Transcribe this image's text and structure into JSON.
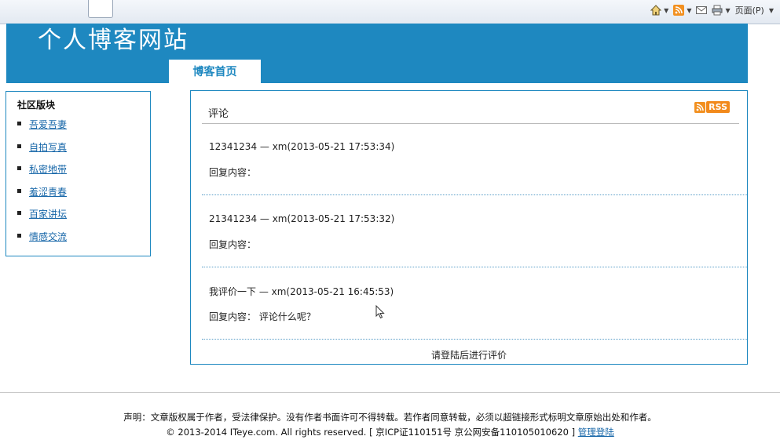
{
  "browser": {
    "page_menu": "页面(P)"
  },
  "header": {
    "site_title": "个人博客网站",
    "nav_tab": "博客首页"
  },
  "sidebar": {
    "title": "社区版块",
    "items": [
      {
        "label": "吾爱吾妻"
      },
      {
        "label": "自拍写真"
      },
      {
        "label": "私密地带"
      },
      {
        "label": "羞涩青春"
      },
      {
        "label": "百家讲坛"
      },
      {
        "label": "情感交流"
      }
    ]
  },
  "main": {
    "title": "评论",
    "rss_label": "RSS",
    "comments": [
      {
        "head": "12341234 — xm(2013-05-21 17:53:34)",
        "body": "回复内容："
      },
      {
        "head": "21341234 — xm(2013-05-21 17:53:32)",
        "body": "回复内容："
      },
      {
        "head": "我评价一下 — xm(2013-05-21 16:45:53)",
        "body": "回复内容： 评论什么呢？"
      }
    ],
    "login_hint": "请登陆后进行评价"
  },
  "footer": {
    "line1": "声明：文章版权属于作者，受法律保护。没有作者书面许可不得转载。若作者同意转载，必须以超链接形式标明文章原始出处和作者。",
    "line2_prefix": "© 2013-2014 ITeye.com. All rights reserved. [ 京ICP证110151号 京公网安备110105010620 ]",
    "admin_link": "管理登陆"
  },
  "colors": {
    "brand_blue": "#1e88c0",
    "link": "#1666a8",
    "rss_orange": "#f28a1c"
  }
}
